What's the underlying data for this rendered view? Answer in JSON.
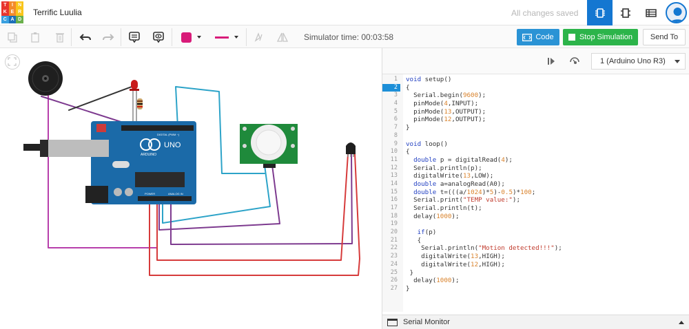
{
  "app": {
    "logo_letters": [
      "T",
      "I",
      "N",
      "K",
      "E",
      "R",
      "C",
      "A",
      "D"
    ],
    "logo_colors": [
      "#e8352e",
      "#f38b2b",
      "#f9c51a",
      "#e8352e",
      "#f38b2b",
      "#f9c51a",
      "#3aa0e0",
      "#1d6fb8",
      "#6ab04c"
    ],
    "project_name": "Terrific Luulia",
    "save_status": "All changes saved",
    "accent_color": "#1477d1"
  },
  "toolbar": {
    "simulator_time": "Simulator time: 00:03:58",
    "code_label": "Code",
    "stop_label": "Stop Simulation",
    "send_label": "Send To",
    "fill_color": "#d81b79",
    "line_color": "#d81b79"
  },
  "canvas": {
    "arduino_brand": "ARDUINO",
    "arduino_model": "UNO",
    "digital_header": "DIGITAL (PWM ~)",
    "power_label": "POWER",
    "analog_label": "ANALOG IN"
  },
  "code_panel": {
    "device": "1 (Arduino Uno R3)",
    "current_line": 2,
    "lines": [
      "void setup()",
      "{",
      "  Serial.begin(9600);",
      "  pinMode(4,INPUT);",
      "  pinMode(13,OUTPUT);",
      "  pinMode(12,OUTPUT);",
      "}",
      "",
      "void loop()",
      "{",
      "  double p = digitalRead(4);",
      "  Serial.println(p);",
      "  digitalWrite(13,LOW);",
      "  double a=analogRead(A0);",
      "  double t=(((a/1024)*5)-0.5)*100;",
      "  Serial.print(\"TEMP value:\");",
      "  Serial.println(t);",
      "  delay(1000);",
      "",
      "   if(p)",
      "   {",
      "    Serial.println(\"Motion detected!!!\");",
      "    digitalWrite(13,HIGH);",
      "    digitalWrite(12,HIGH);",
      " }",
      "  delay(1000);",
      "}"
    ],
    "serial_monitor_label": "Serial Monitor"
  }
}
